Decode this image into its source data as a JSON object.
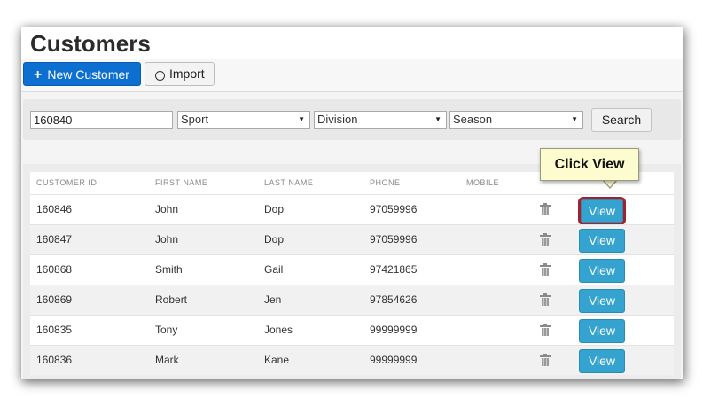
{
  "header": {
    "title": "Customers"
  },
  "toolbar": {
    "new_customer_label": "New Customer",
    "import_label": "Import"
  },
  "search": {
    "customer_id_value": "160840",
    "sport": "Sport",
    "division": "Division",
    "season": "Season",
    "search_label": "Search"
  },
  "table": {
    "columns": [
      "CUSTOMER ID",
      "FIRST NAME",
      "LAST NAME",
      "PHONE",
      "MOBILE"
    ],
    "rows": [
      {
        "id": "160846",
        "first": "John",
        "last": "Dop",
        "phone": "97059996",
        "mobile": "",
        "action": "View"
      },
      {
        "id": "160847",
        "first": "John",
        "last": "Dop",
        "phone": "97059996",
        "mobile": "",
        "action": "View"
      },
      {
        "id": "160868",
        "first": "Smith",
        "last": "Gail",
        "phone": "97421865",
        "mobile": "",
        "action": "View"
      },
      {
        "id": "160869",
        "first": "Robert",
        "last": "Jen",
        "phone": "97854626",
        "mobile": "",
        "action": "View"
      },
      {
        "id": "160835",
        "first": "Tony",
        "last": "Jones",
        "phone": "99999999",
        "mobile": "",
        "action": "View"
      },
      {
        "id": "160836",
        "first": "Mark",
        "last": "Kane",
        "phone": "99999999",
        "mobile": "",
        "action": "View"
      }
    ]
  },
  "callout": {
    "text": "Click View"
  },
  "icons": {
    "new": "plus-icon",
    "import": "import-icon",
    "delete": "trash-icon",
    "dropdown": "chevron-down-icon"
  },
  "colors": {
    "primary": "#0d6fcf",
    "view_button": "#35a3cf",
    "highlight": "#a4202a",
    "callout_bg": "#fdfccf"
  }
}
